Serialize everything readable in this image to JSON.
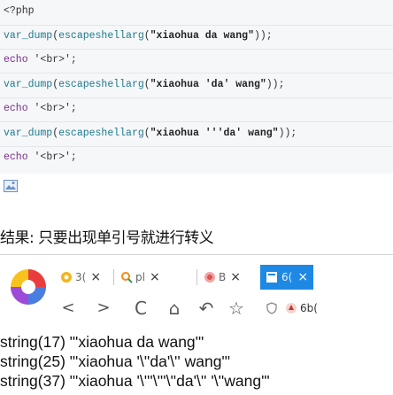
{
  "code": {
    "open_tag": "<?php",
    "lines": [
      {
        "fn": "var_dump",
        "inner_fn": "escapeshellarg",
        "arg": "\"xiaohua da wang\"",
        "tail": "));"
      },
      {
        "kw": "echo",
        "arg": "'<br>';"
      },
      {
        "fn": "var_dump",
        "inner_fn": "escapeshellarg",
        "arg": "\"xiaohua 'da' wang\"",
        "tail": "));"
      },
      {
        "kw": "echo",
        "arg": "'<br>';"
      },
      {
        "fn": "var_dump",
        "inner_fn": "escapeshellarg",
        "arg": "\"xiaohua '''da' wang\"",
        "tail": "));"
      },
      {
        "kw": "echo",
        "arg": "'<br>';"
      }
    ]
  },
  "conclusion": "结果: 只要出现单引号就进行转义",
  "browser": {
    "tabs": [
      {
        "icon": "browser-icon",
        "label": "3(",
        "close": "×"
      },
      {
        "icon": "search-icon",
        "label": "pl",
        "close": "×"
      },
      {
        "icon": "page-icon",
        "label": "B",
        "close": "×"
      }
    ],
    "active_tab": {
      "label": "6(",
      "close": "×"
    },
    "nav": {
      "back": "<",
      "forward": ">",
      "reload": "C",
      "home": "⌂",
      "undo": "↶",
      "bookmark": "☆"
    },
    "address": "6b("
  },
  "output": [
    "string(17) \"'xiaohua da wang'\"",
    "string(25) \"'xiaohua '\\''da'\\'' wang'\"",
    "string(37) \"'xiaohua '\\'''\\'''\\''da'\\'' '\\''wang'\""
  ],
  "colors": {
    "accent": "#1e88e5",
    "code_bg": "#f6f7f9"
  }
}
